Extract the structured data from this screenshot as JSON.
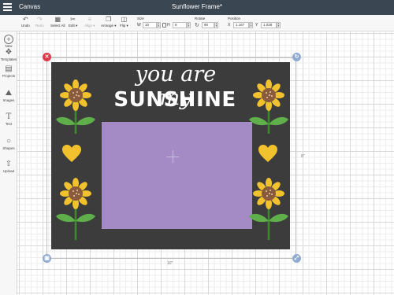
{
  "topbar": {
    "app_title": "Canvas",
    "doc_title": "Sunflower Frame*"
  },
  "toolbar": {
    "undo": "Undo",
    "redo": "Redo",
    "select_all": "Select All",
    "edit": "Edit ▾",
    "align": "Align ▾",
    "arrange": "Arrange ▾",
    "flip": "Flip ▾",
    "size_label": "Size",
    "w_label": "W",
    "w_value": "10",
    "h_label": "H",
    "h_value": "8",
    "rotate_label": "Rotate",
    "rotate_value": "90",
    "position_label": "Position",
    "x_label": "X",
    "x_value": "1.167",
    "y_label": "Y",
    "y_value": "1.028"
  },
  "sidebar": {
    "items": [
      {
        "label": "New",
        "icon": "plus-icon"
      },
      {
        "label": "Templates",
        "icon": "shirt-icon"
      },
      {
        "label": "Projects",
        "icon": "projects-icon"
      },
      {
        "label": "Images",
        "icon": "image-icon"
      },
      {
        "label": "Text",
        "icon": "text-icon"
      },
      {
        "label": "Shapes",
        "icon": "shapes-icon"
      },
      {
        "label": "Upload",
        "icon": "upload-icon"
      }
    ]
  },
  "design": {
    "line1": "you are my",
    "line2": "SUNSHINE",
    "background_color": "#3c3c3c",
    "photo_color": "#a48bc6",
    "petal_color": "#f2c12e",
    "leaf_color": "#5fb04a"
  },
  "dimensions": {
    "width": "10\"",
    "height": "8\""
  },
  "colors": {
    "topbar": "#3a4652",
    "close_handle": "#e0384a",
    "handle": "#8faad1"
  }
}
